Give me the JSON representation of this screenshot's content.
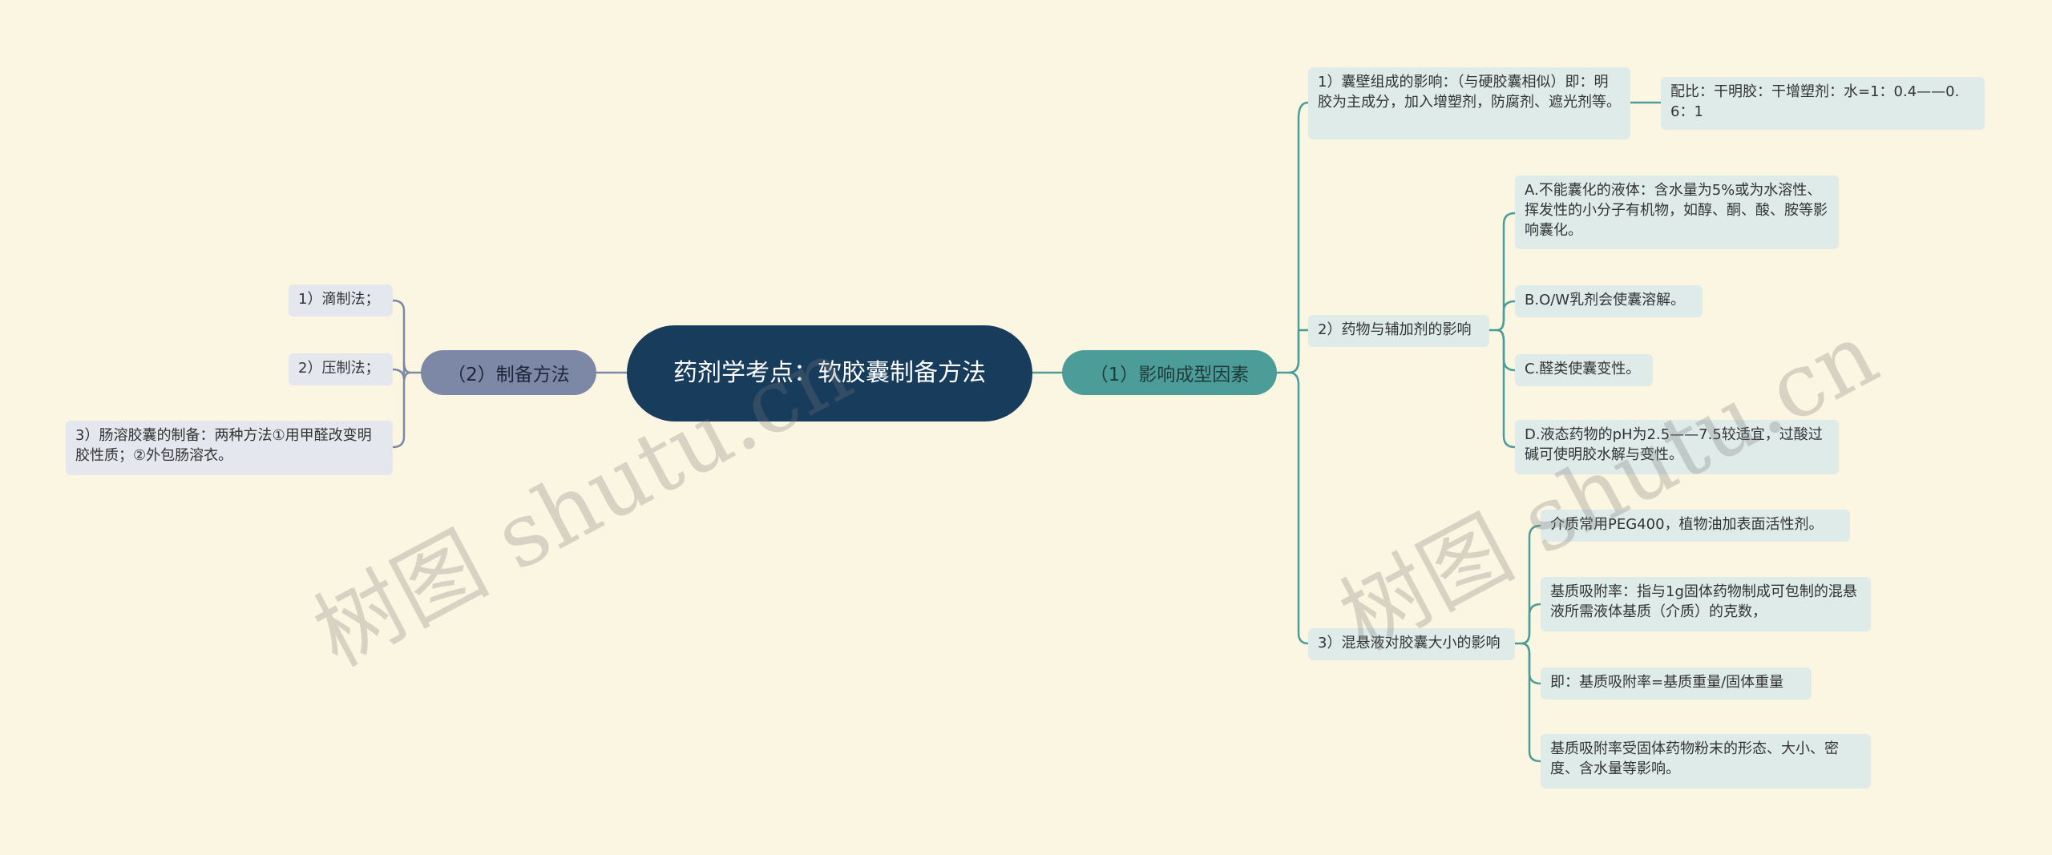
{
  "root": {
    "title": "药剂学考点：软胶囊制备方法"
  },
  "branches": {
    "influence": {
      "label": "（1）影响成型因素"
    },
    "method": {
      "label": "（2）制备方法"
    }
  },
  "influence_nodes": {
    "wall": "1）囊壁组成的影响：（与硬胶囊相似）即：明胶为主成分，加入增塑剂，防腐剂、遮光剂等。",
    "wall_ratio": "配比：干明胶：干增塑剂：水=1：0.4——0.6：1",
    "drug": "2）药物与辅加剂的影响",
    "drug_a": "A.不能囊化的液体：含水量为5%或为水溶性、挥发性的小分子有机物，如醇、酮、酸、胺等影响囊化。",
    "drug_b": "B.O/W乳剂会使囊溶解。",
    "drug_c": "C.醛类使囊变性。",
    "drug_d": "D.液态药物的pH为2.5——7.5较适宜，过酸过碱可使明胶水解与变性。",
    "suspension": "3）混悬液对胶囊大小的影响",
    "susp_1": "介质常用PEG400，植物油加表面活性剂。",
    "susp_2": "基质吸附率：指与1g固体药物制成可包制的混悬液所需液体基质（介质）的克数，",
    "susp_3": "即：基质吸附率=基质重量/固体重量",
    "susp_4": "基质吸附率受固体药物粉末的形态、大小、密度、含水量等影响。"
  },
  "method_nodes": {
    "drip": "1）滴制法；",
    "press": "2）压制法；",
    "enteric": "3）肠溶胶囊的制备：两种方法①用甲醛改变明胶性质；②外包肠溶衣。"
  },
  "watermarks": [
    "树图 shutu.cn",
    "树图 shutu.cn"
  ],
  "colors": {
    "background": "#fbf6e2",
    "root": "#173c5c",
    "right_branch": "#4c9d99",
    "left_branch": "#7d87a6",
    "right_node": "#deebe9",
    "left_node": "#e5e7ee",
    "link_right": "#4c9d99",
    "link_left": "#7d87a6"
  }
}
